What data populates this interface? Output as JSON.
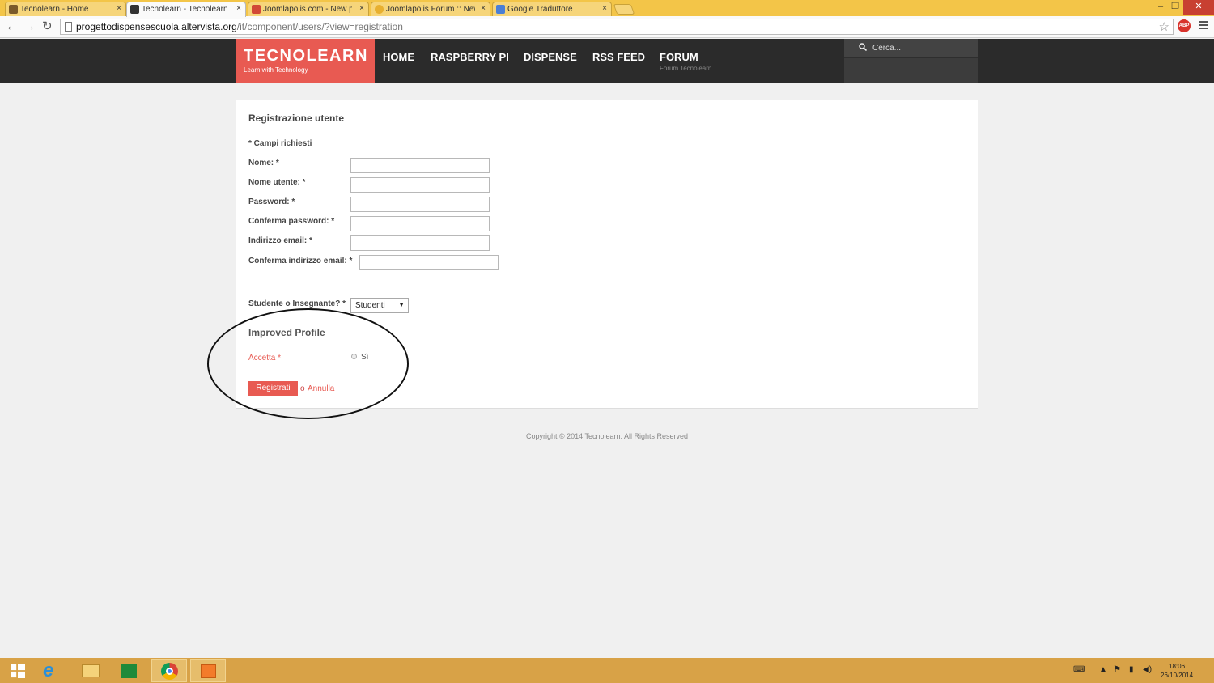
{
  "browser": {
    "tabs": [
      {
        "label": "Tecnolearn - Home",
        "active": false,
        "favicon_color": "#7a5a2a"
      },
      {
        "label": "Tecnolearn - Tecnolearn",
        "active": true,
        "favicon_color": "#333333"
      },
      {
        "label": "Joomlapolis.com - New p",
        "active": false,
        "favicon_color": "#d14836"
      },
      {
        "label": "Joomlapolis Forum :: New",
        "active": false,
        "favicon_color": "#e8b030"
      },
      {
        "label": "Google Traduttore",
        "active": false,
        "favicon_color": "#4a7fd6"
      }
    ],
    "tab_close": "×",
    "window_controls": {
      "minimize": "–",
      "restore": "❐",
      "close": "✕"
    },
    "url_host": "progettodispensescuola.altervista.org",
    "url_path": "/it/component/users/?view=registration",
    "abp_label": "ABP"
  },
  "site": {
    "logo_title": "TECNOLEARN",
    "logo_tagline": "Learn with Technology",
    "nav": [
      {
        "label": "HOME",
        "sub": ""
      },
      {
        "label": "RASPBERRY PI",
        "sub": ""
      },
      {
        "label": "DISPENSE",
        "sub": ""
      },
      {
        "label": "RSS FEED",
        "sub": ""
      },
      {
        "label": "FORUM",
        "sub": "Forum Tecnolearn"
      }
    ],
    "search_placeholder": "Cerca..."
  },
  "form": {
    "title": "Registrazione utente",
    "required_note": "* Campi richiesti",
    "fields": [
      {
        "label": "Nome: *",
        "value": ""
      },
      {
        "label": "Nome utente: *",
        "value": ""
      },
      {
        "label": "Password: *",
        "value": ""
      },
      {
        "label": "Conferma password: *",
        "value": ""
      },
      {
        "label": "Indirizzo email: *",
        "value": ""
      },
      {
        "label": "Conferma indirizzo email: *",
        "value": ""
      }
    ],
    "role_label": "Studente o Insegnante? *",
    "role_selected": "Studenti",
    "section_title": "Improved Profile",
    "accept_label": "Accetta *",
    "accept_option": "Sì",
    "submit_label": "Registrati",
    "or_text": "o",
    "cancel_label": "Annulla"
  },
  "footer": {
    "copyright": "Copyright © 2014 Tecnolearn. All Rights Reserved"
  },
  "taskbar": {
    "time": "18:06",
    "date": "26/10/2014"
  },
  "colors": {
    "accent": "#e85a52",
    "header_bg": "#2b2b2b",
    "taskbar": "#d8a247",
    "tabstrip": "#f3c548"
  }
}
